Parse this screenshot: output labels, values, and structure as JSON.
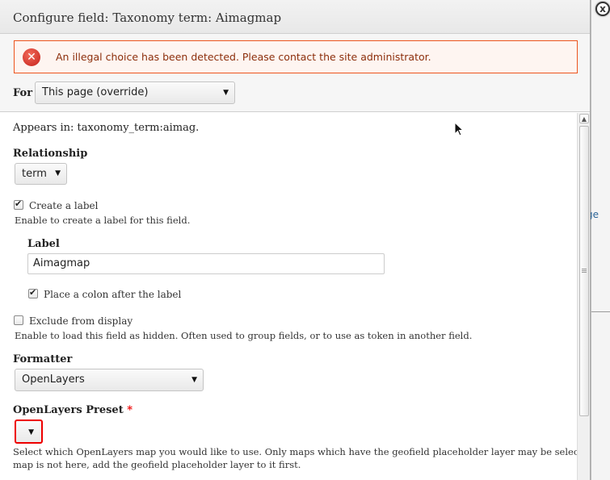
{
  "dialog": {
    "title": "Configure field: Taxonomy term: Aimagmap",
    "close_symbol": "x"
  },
  "error": {
    "icon": "error-icon",
    "icon_symbol": "✕",
    "message": "An illegal choice has been detected. Please contact the site administrator."
  },
  "for_field": {
    "label": "For",
    "value": "This page (override)"
  },
  "form": {
    "appears_in": "Appears in: taxonomy_term:aimag.",
    "relationship": {
      "label": "Relationship",
      "value": "term"
    },
    "create_label": {
      "label": "Create a label",
      "checked": true,
      "description": "Enable to create a label for this field."
    },
    "label_field": {
      "label": "Label",
      "value": "Aimagmap"
    },
    "colon": {
      "label": "Place a colon after the label",
      "checked": true
    },
    "exclude": {
      "label": "Exclude from display",
      "checked": false,
      "description": "Enable to load this field as hidden. Often used to group fields, or to use as token in another field."
    },
    "formatter": {
      "label": "Formatter",
      "value": "OpenLayers"
    },
    "preset": {
      "label": "OpenLayers Preset",
      "required_mark": "*",
      "value": "",
      "description_line1": "Select which OpenLayers map you would like to use. Only maps which have the geofield placeholder layer may be selected. If your preferred",
      "description_line2": "map is not here, add the geofield placeholder layer to it first."
    }
  },
  "background": {
    "link_fragment": "ge"
  },
  "colors": {
    "error_border": "#ed541d",
    "error_text": "#8c2e0b",
    "required": "#ee0000"
  }
}
